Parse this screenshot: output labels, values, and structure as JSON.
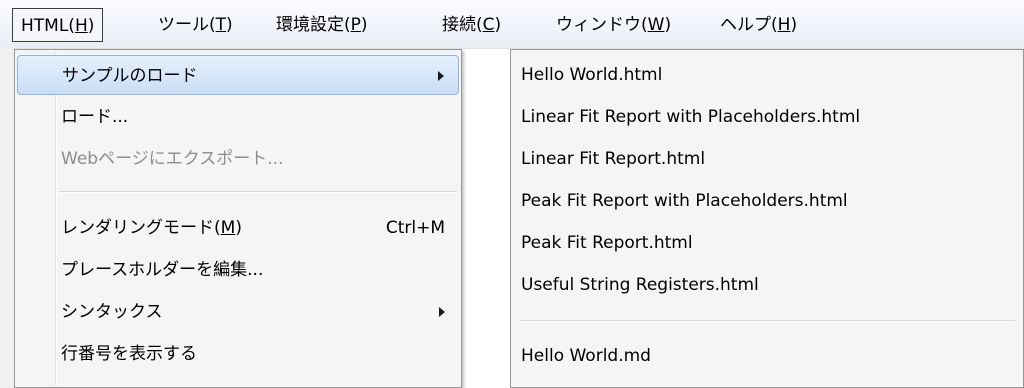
{
  "menubar": {
    "items": [
      {
        "label": "HTML(",
        "acc": "H",
        "close": ")"
      },
      {
        "label": "ツール(",
        "acc": "T",
        "close": ")"
      },
      {
        "label": "環境設定(",
        "acc": "P",
        "close": ")"
      },
      {
        "label": "接続(",
        "acc": "C",
        "close": ")"
      },
      {
        "label": "ウィンドウ(",
        "acc": "W",
        "close": ")"
      },
      {
        "label": "ヘルプ(",
        "acc": "H",
        "close": ")"
      }
    ]
  },
  "html_menu": {
    "items": [
      {
        "label": "サンプルのロード"
      },
      {
        "label": "ロード..."
      },
      {
        "label": "Webページにエクスポート..."
      },
      {
        "label": "レンダリングモード(",
        "acc": "M",
        "close": ")",
        "shortcut": "Ctrl+M"
      },
      {
        "label": "プレースホルダーを編集..."
      },
      {
        "label": "シンタックス"
      },
      {
        "label": "行番号を表示する"
      }
    ]
  },
  "samples_menu": {
    "items": [
      {
        "label": "Hello World.html"
      },
      {
        "label": "Linear Fit Report with Placeholders.html"
      },
      {
        "label": "Linear Fit Report.html"
      },
      {
        "label": "Peak Fit Report with Placeholders.html"
      },
      {
        "label": "Peak Fit Report.html"
      },
      {
        "label": "Useful String Registers.html"
      },
      {
        "label": "Hello World.md"
      }
    ]
  },
  "colors": {
    "highlight": "#c9ddf6",
    "menu_bg": "#f5f5f5",
    "disabled_text": "#8d8d8d"
  }
}
